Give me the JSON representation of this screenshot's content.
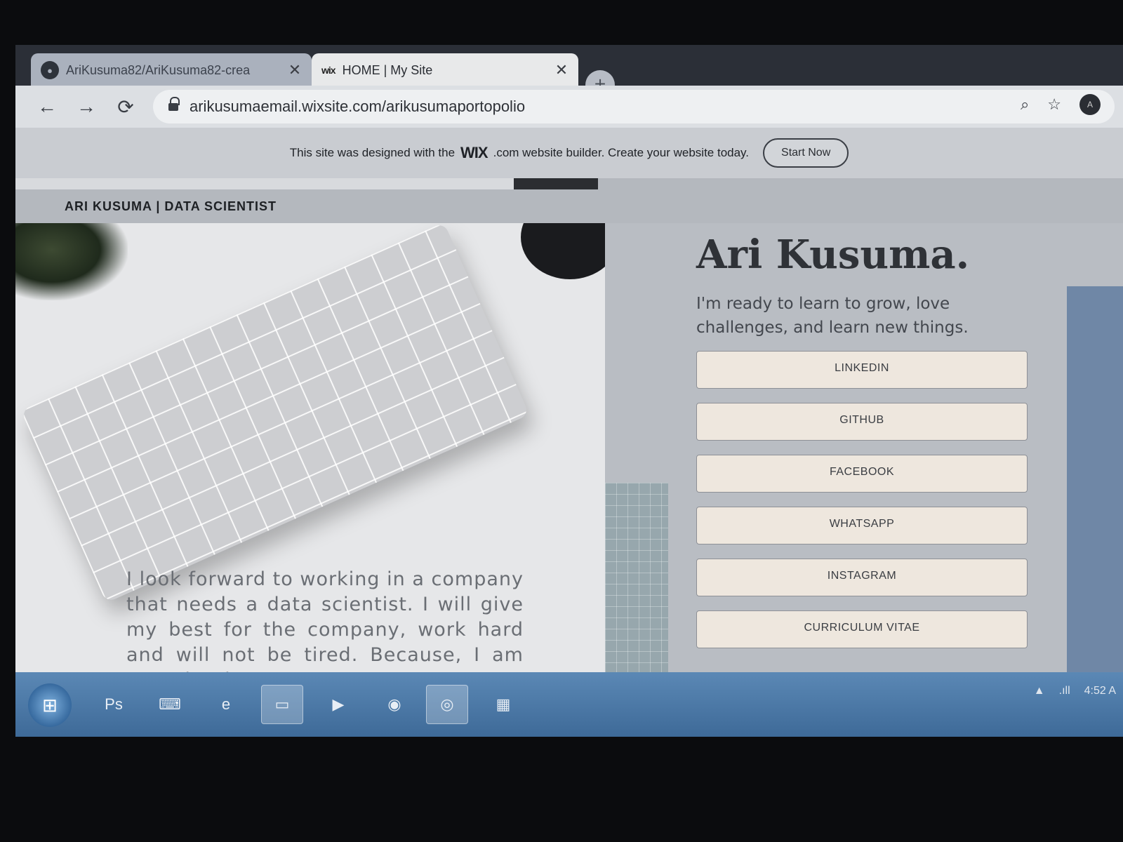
{
  "browser": {
    "tabs": [
      {
        "label": "AriKusuma82/AriKusuma82-crea",
        "icon": "github-icon"
      },
      {
        "label": "HOME | My Site",
        "icon": "wix-icon"
      }
    ],
    "url": "arikusumaemail.wixsite.com/arikusumaportopolio",
    "profile_initial": "A"
  },
  "wix_banner": {
    "text_before": "This site was designed with the",
    "logo": "WIX",
    "text_after": ".com website builder. Create your website today.",
    "button": "Start Now"
  },
  "site": {
    "header_title": "ARI KUSUMA | DATA SCIENTIST",
    "name": "Ari Kusuma.",
    "tagline": "I'm ready to learn to grow, love challenges, and learn new things.",
    "intro": "I look forward to working in a company that needs a data scientist. I will give my best for the company, work hard and will not be tired.  Because, I am sure that by",
    "links": [
      "LINKEDIN",
      "GITHUB",
      "FACEBOOK",
      "WHATSAPP",
      "INSTAGRAM",
      "CURRICULUM VITAE"
    ]
  },
  "taskbar": {
    "apps": [
      "Ps"
    ],
    "clock": "4:52 A"
  },
  "colors": {
    "button_bg": "#eee7de",
    "taskbar": "#4b7aa8",
    "header_bg": "#b4b8be"
  }
}
